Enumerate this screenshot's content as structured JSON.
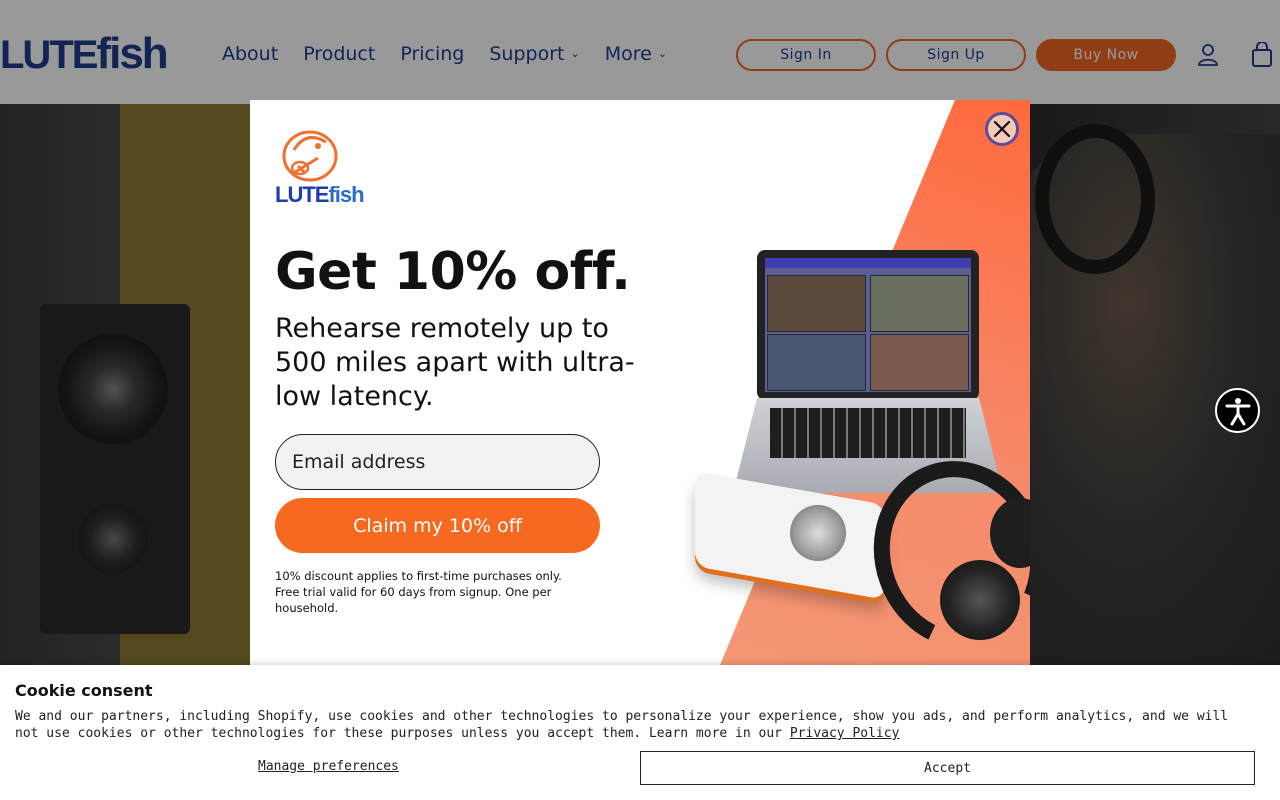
{
  "header": {
    "logo_caps": "LUTE",
    "logo_rest": "fish",
    "nav": [
      {
        "label": "About",
        "has_dropdown": false
      },
      {
        "label": "Product",
        "has_dropdown": false
      },
      {
        "label": "Pricing",
        "has_dropdown": false
      },
      {
        "label": "Support",
        "has_dropdown": true
      },
      {
        "label": "More",
        "has_dropdown": true
      }
    ],
    "sign_in": "Sign In",
    "sign_up": "Sign Up",
    "buy_now": "Buy Now",
    "account_icon": "user-icon",
    "cart_icon": "cart-icon"
  },
  "modal": {
    "logo_caps": "LUTE",
    "logo_rest": "fish",
    "headline": "Get 10% off.",
    "subhead": "Rehearse remotely up to 500 miles apart with ultra-low latency.",
    "email_placeholder": "Email address",
    "cta": "Claim my 10% off",
    "fine_print": "10% discount applies to first-time purchases only. Free trial valid for 60 days from signup. One per household.",
    "close_icon": "close-icon"
  },
  "cookie": {
    "title": "Cookie consent",
    "body": "We and our partners, including Shopify, use cookies and other technologies to personalize your experience, show you ads, and perform analytics, and we will not use cookies or other technologies for these purposes unless you accept them. Learn more in our ",
    "privacy_link": "Privacy Policy",
    "manage": "Manage preferences",
    "accept": "Accept"
  },
  "colors": {
    "brand_blue": "#1f3c8c",
    "brand_orange": "#f26722",
    "cta_orange": "#f7691f"
  }
}
